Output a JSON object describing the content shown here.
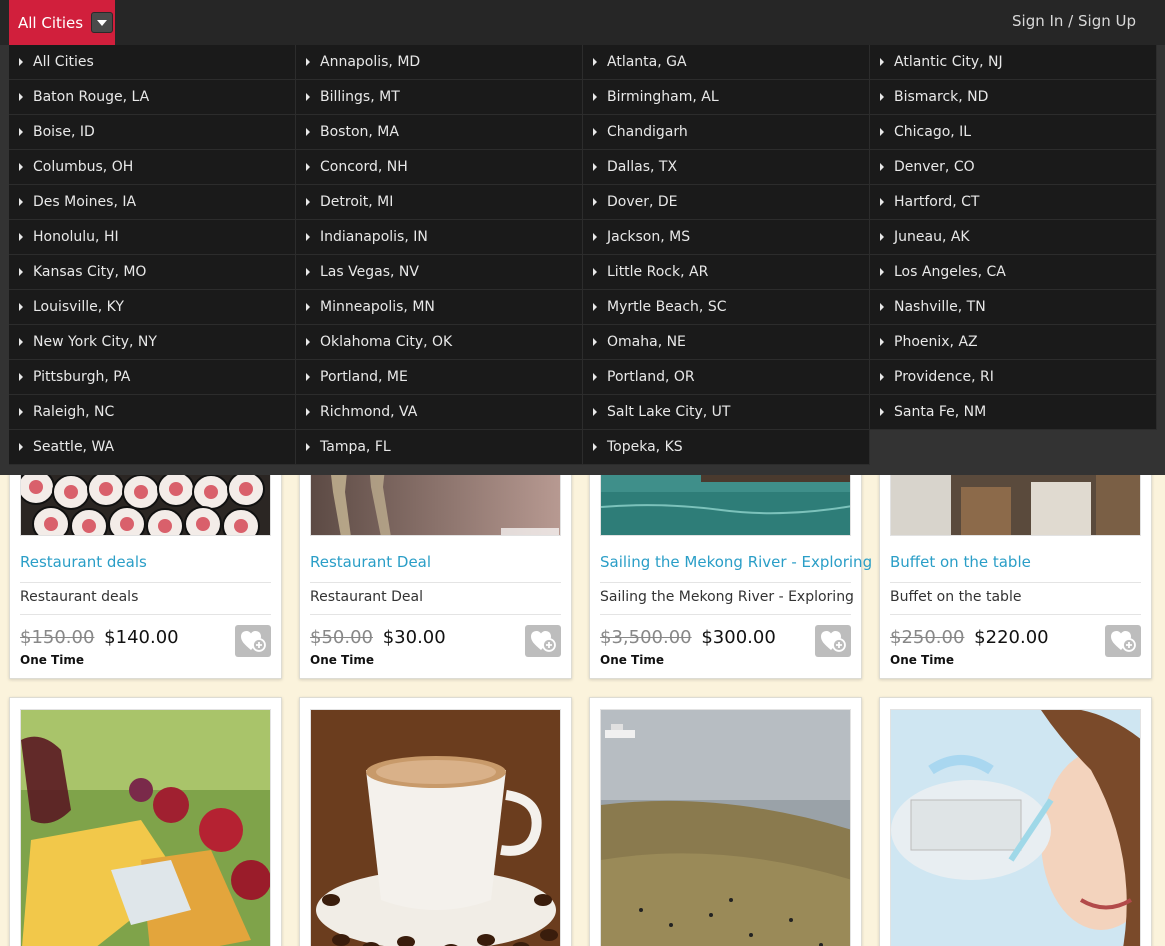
{
  "topbar": {
    "city_label": "All Cities",
    "signin_label": "Sign In / Sign Up"
  },
  "cities": [
    "All Cities",
    "Annapolis, MD",
    "Atlanta, GA",
    "Atlantic City, NJ",
    "Baton Rouge, LA",
    "Billings, MT",
    "Birmingham, AL",
    "Bismarck, ND",
    "Boise, ID",
    "Boston, MA",
    "Chandigarh",
    "Chicago, IL",
    "Columbus, OH",
    "Concord, NH",
    "Dallas, TX",
    "Denver, CO",
    "Des Moines, IA",
    "Detroit, MI",
    "Dover, DE",
    "Hartford, CT",
    "Honolulu, HI",
    "Indianapolis, IN",
    "Jackson, MS",
    "Juneau, AK",
    "Kansas City, MO",
    "Las Vegas, NV",
    "Little Rock, AR",
    "Los Angeles, CA",
    "Louisville, KY",
    "Minneapolis, MN",
    "Myrtle Beach, SC",
    "Nashville, TN",
    "New York City, NY",
    "Oklahoma City, OK",
    "Omaha, NE",
    "Phoenix, AZ",
    "Pittsburgh, PA",
    "Portland, ME",
    "Portland, OR",
    "Providence, RI",
    "Raleigh, NC",
    "Richmond, VA",
    "Salt Lake City, UT",
    "Santa Fe, NM",
    "Seattle, WA",
    "Tampa, FL",
    "Topeka, KS"
  ],
  "deals": [
    {
      "title": "Restaurant deals",
      "subtitle": "Restaurant deals",
      "old_price": "$150.00",
      "new_price": "$140.00",
      "frequency": "One Time"
    },
    {
      "title": "Restaurant Deal",
      "subtitle": "Restaurant Deal",
      "old_price": "$50.00",
      "new_price": "$30.00",
      "frequency": "One Time"
    },
    {
      "title": "Sailing the Mekong River - Exploring",
      "subtitle": "Sailing the Mekong River - Exploring",
      "old_price": "$3,500.00",
      "new_price": "$300.00",
      "frequency": "One Time"
    },
    {
      "title": "Buffet on the table",
      "subtitle": "Buffet on the table",
      "old_price": "$250.00",
      "new_price": "$220.00",
      "frequency": "One Time"
    }
  ],
  "icons": {
    "caret": "caret-down-icon",
    "arrow": "arrow-right-icon",
    "favorite": "heart-plus-icon"
  },
  "colors": {
    "accent": "#d11f3c",
    "link": "#2a9ec7",
    "topbar": "#262626",
    "page_bg": "#fbf3dc"
  }
}
